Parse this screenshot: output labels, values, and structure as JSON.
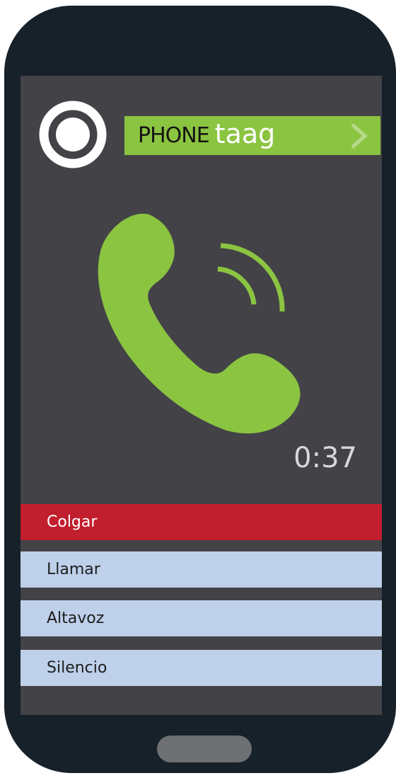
{
  "brand": {
    "phone": "PHONE",
    "taag": "taag"
  },
  "call": {
    "timer": "0:37"
  },
  "actions": [
    {
      "label": "Colgar"
    },
    {
      "label": "Llamar"
    },
    {
      "label": "Altavoz"
    },
    {
      "label": "Silencio"
    }
  ],
  "icons": {
    "record": "record-icon",
    "chevron": "chevron-right-icon",
    "call": "phone-call-icon",
    "home": "home-button"
  },
  "colors": {
    "device": "#16212a",
    "screen": "#434247",
    "accent": "#8bc441",
    "hangup": "#c11e2e",
    "action": "#bed0ea"
  }
}
